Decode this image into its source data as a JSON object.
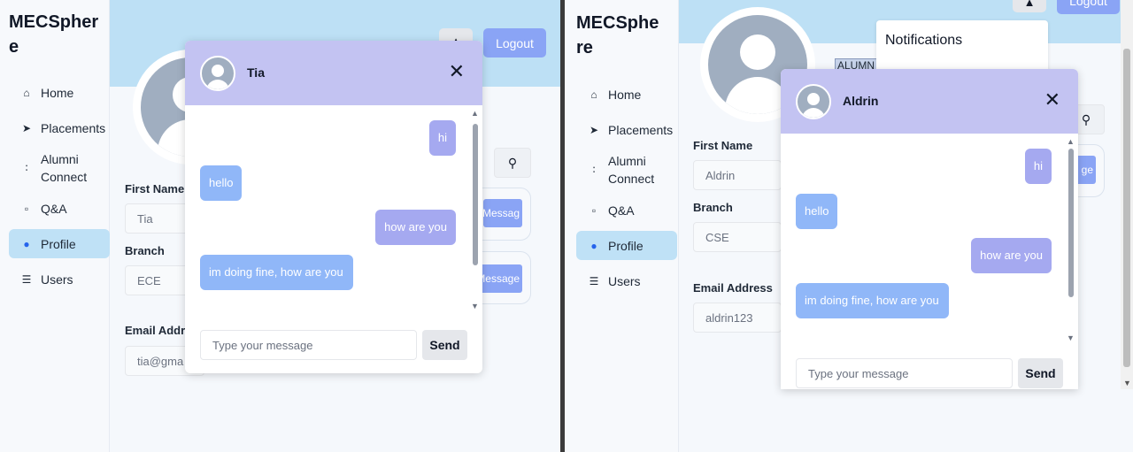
{
  "left_window": {
    "brand": "MECSphere",
    "nav": [
      {
        "label": "Home",
        "icon": "home-icon"
      },
      {
        "label": "Placements",
        "icon": "rocket-icon"
      },
      {
        "label": "Alumni Connect",
        "icon": "users-icon"
      },
      {
        "label": "Q&A",
        "icon": "chat-icon"
      },
      {
        "label": "Profile",
        "icon": "user-icon"
      },
      {
        "label": "Users",
        "icon": "list-icon"
      }
    ],
    "active_nav": "Profile",
    "logout_label": "Logout",
    "profile": {
      "first_name_label": "First Name",
      "first_name_value": "Tia",
      "branch_label": "Branch",
      "branch_value": "ECE",
      "email_label": "Email Addre",
      "email_value": "tia@gma"
    },
    "background_buttons": [
      "Messag",
      "Message"
    ],
    "chat": {
      "contact_name": "Tia",
      "messages": [
        {
          "direction": "out",
          "text": "hi"
        },
        {
          "direction": "in",
          "text": "hello"
        },
        {
          "direction": "out",
          "text": "how are you"
        },
        {
          "direction": "in",
          "text": "im doing fine, how are you"
        }
      ],
      "input_placeholder": "Type your message",
      "send_label": "Send"
    }
  },
  "right_window": {
    "brand": "MECSphere",
    "nav": [
      {
        "label": "Home",
        "icon": "home-icon"
      },
      {
        "label": "Placements",
        "icon": "rocket-icon"
      },
      {
        "label": "Alumni Connect",
        "icon": "users-icon"
      },
      {
        "label": "Q&A",
        "icon": "chat-icon"
      },
      {
        "label": "Profile",
        "icon": "user-icon"
      },
      {
        "label": "Users",
        "icon": "list-icon"
      }
    ],
    "active_nav": "Profile",
    "logout_label": "Logout",
    "notifications_title": "Notifications",
    "alumni_tag": "ALUMN",
    "profile": {
      "first_name_label": "First Name",
      "first_name_value": "Aldrin",
      "branch_label": "Branch",
      "branch_value": "CSE",
      "email_label": "Email Address",
      "email_value": "aldrin123"
    },
    "background_buttons": [
      "ge"
    ],
    "chat": {
      "contact_name": "Aldrin",
      "messages": [
        {
          "direction": "out",
          "text": "hi"
        },
        {
          "direction": "in",
          "text": "hello"
        },
        {
          "direction": "out",
          "text": "how are you"
        },
        {
          "direction": "in",
          "text": "im doing fine, how are you"
        }
      ],
      "input_placeholder": "Type your message",
      "send_label": "Send"
    }
  },
  "colors": {
    "banner": "#bde0f5",
    "chat_header": "#c3c3f2",
    "outgoing_bubble": "#a5a9f0",
    "incoming_bubble": "#90b7f8",
    "primary_button": "#8aa4f5",
    "active_nav": "#bfe1f6"
  }
}
